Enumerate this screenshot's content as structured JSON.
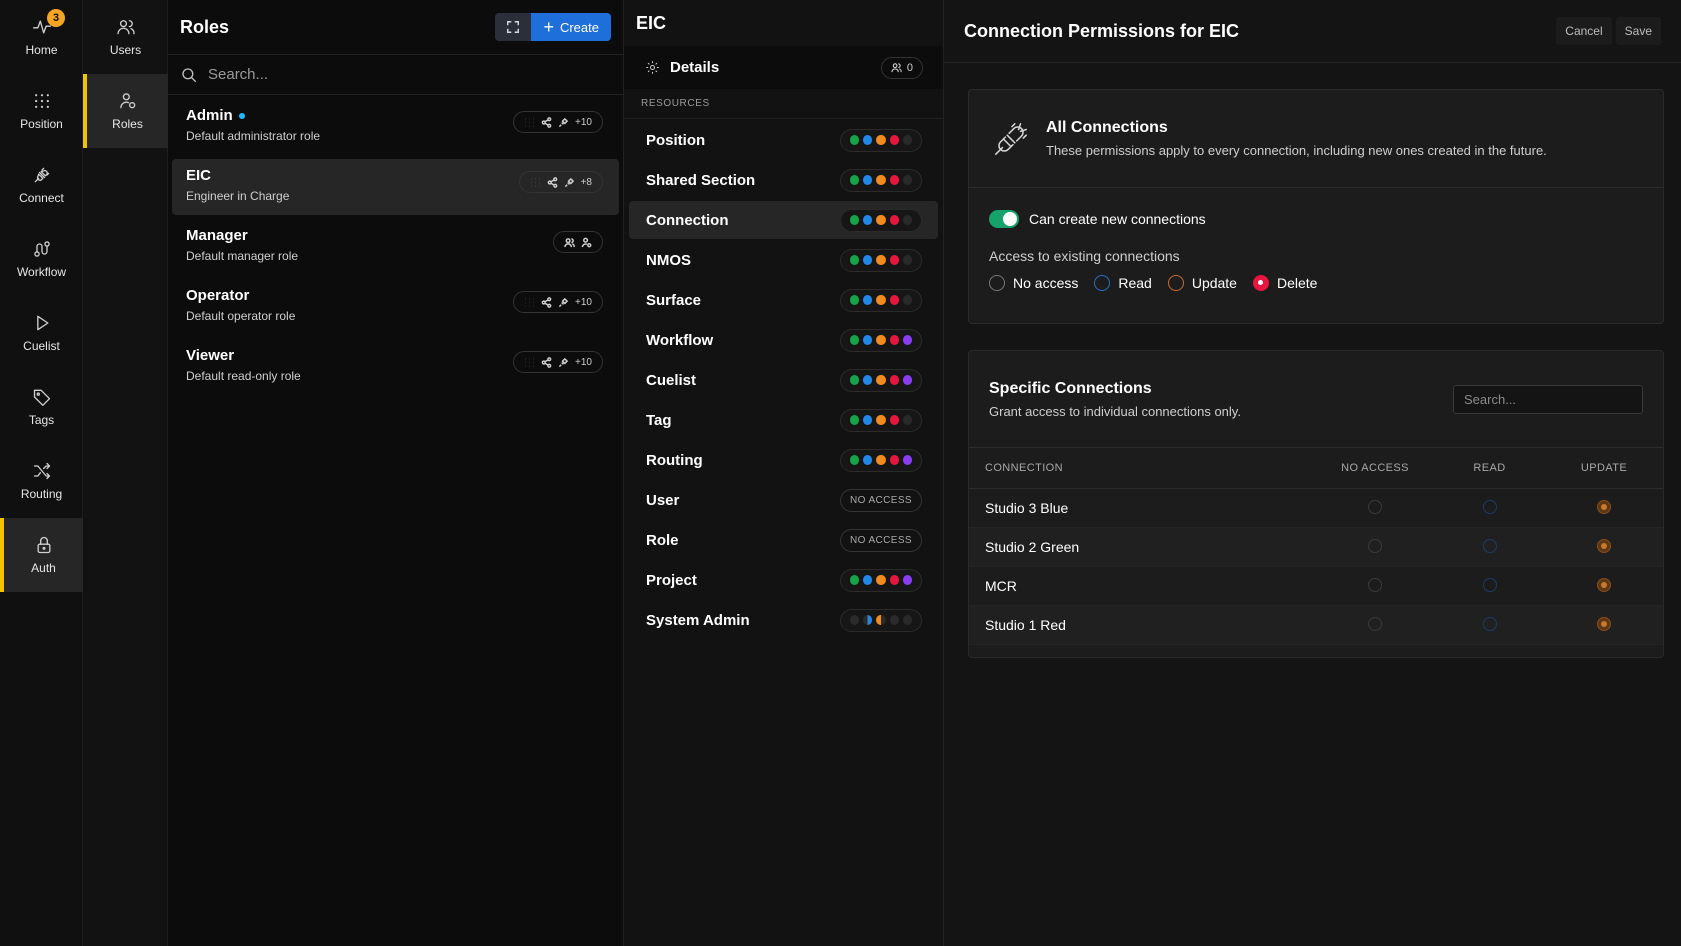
{
  "nav": {
    "items": [
      {
        "label": "Home",
        "icon": "pulse-icon",
        "badge": "3"
      },
      {
        "label": "Position",
        "icon": "grid-icon"
      },
      {
        "label": "Connect",
        "icon": "plug-icon"
      },
      {
        "label": "Workflow",
        "icon": "workflow-icon"
      },
      {
        "label": "Cuelist",
        "icon": "play-icon"
      },
      {
        "label": "Tags",
        "icon": "tag-icon"
      },
      {
        "label": "Routing",
        "icon": "shuffle-icon"
      },
      {
        "label": "Auth",
        "icon": "lock-icon"
      }
    ],
    "active": "Auth"
  },
  "subnav": {
    "items": [
      {
        "label": "Users",
        "icon": "users-icon"
      },
      {
        "label": "Roles",
        "icon": "roles-icon"
      }
    ],
    "active": "Roles"
  },
  "roles": {
    "title": "Roles",
    "create_label": "Create",
    "search_placeholder": "Search...",
    "items": [
      {
        "name": "Admin",
        "desc": "Default administrator role",
        "count": "+10",
        "online": true
      },
      {
        "name": "EIC",
        "desc": "Engineer in Charge",
        "count": "+8",
        "selected": true
      },
      {
        "name": "Manager",
        "desc": "Default manager role",
        "count": ""
      },
      {
        "name": "Operator",
        "desc": "Default operator role",
        "count": "+10"
      },
      {
        "name": "Viewer",
        "desc": "Default read-only role",
        "count": "+10"
      }
    ]
  },
  "resources": {
    "title": "EIC",
    "details_label": "Details",
    "user_count": "0",
    "section_label": "RESOURCES",
    "no_access_label": "NO ACCESS",
    "rows": [
      {
        "name": "Position",
        "dots": [
          "green",
          "blue",
          "orange",
          "red",
          "off"
        ]
      },
      {
        "name": "Shared Section",
        "dots": [
          "green",
          "blue",
          "orange",
          "red",
          "off"
        ]
      },
      {
        "name": "Connection",
        "dots": [
          "green",
          "blue",
          "orange",
          "red",
          "off"
        ],
        "selected": true
      },
      {
        "name": "NMOS",
        "dots": [
          "green",
          "blue",
          "orange",
          "red",
          "off"
        ]
      },
      {
        "name": "Surface",
        "dots": [
          "green",
          "blue",
          "orange",
          "red",
          "off"
        ]
      },
      {
        "name": "Workflow",
        "dots": [
          "green",
          "blue",
          "orange",
          "red",
          "purple"
        ]
      },
      {
        "name": "Cuelist",
        "dots": [
          "green",
          "blue",
          "orange",
          "red",
          "purple"
        ]
      },
      {
        "name": "Tag",
        "dots": [
          "green",
          "blue",
          "orange",
          "red",
          "off"
        ]
      },
      {
        "name": "Routing",
        "dots": [
          "green",
          "blue",
          "orange",
          "red",
          "purple"
        ]
      },
      {
        "name": "User",
        "no_access": true
      },
      {
        "name": "Role",
        "no_access": true
      },
      {
        "name": "Project",
        "dots": [
          "green",
          "blue",
          "orange",
          "red",
          "purple"
        ]
      },
      {
        "name": "System Admin",
        "dots": [
          "off",
          "half-blue",
          "half-orange",
          "off",
          "off"
        ]
      }
    ],
    "colors": {
      "green": "#16a34a",
      "blue": "#2388e6",
      "orange": "#f28b1e",
      "red": "#e8163f",
      "purple": "#8b3df0",
      "off": "#2a2a2a"
    }
  },
  "perm": {
    "title": "Connection Permissions for EIC",
    "cancel_label": "Cancel",
    "save_label": "Save",
    "all": {
      "title": "All Connections",
      "subtitle": "These permissions apply to every connection, including new ones created in the future.",
      "toggle_label": "Can create new connections",
      "toggle_on": true,
      "access_label": "Access to existing connections",
      "options": [
        "No access",
        "Read",
        "Update",
        "Delete"
      ],
      "selected": "Delete"
    },
    "specific": {
      "title": "Specific Connections",
      "subtitle": "Grant access to individual connections only.",
      "search_placeholder": "Search...",
      "columns": [
        "CONNECTION",
        "NO ACCESS",
        "READ",
        "UPDATE"
      ],
      "rows": [
        {
          "name": "Studio 3 Blue",
          "value": "UPDATE"
        },
        {
          "name": "Studio 2 Green",
          "value": "UPDATE"
        },
        {
          "name": "MCR",
          "value": "UPDATE"
        },
        {
          "name": "Studio 1 Red",
          "value": "UPDATE"
        }
      ]
    }
  }
}
